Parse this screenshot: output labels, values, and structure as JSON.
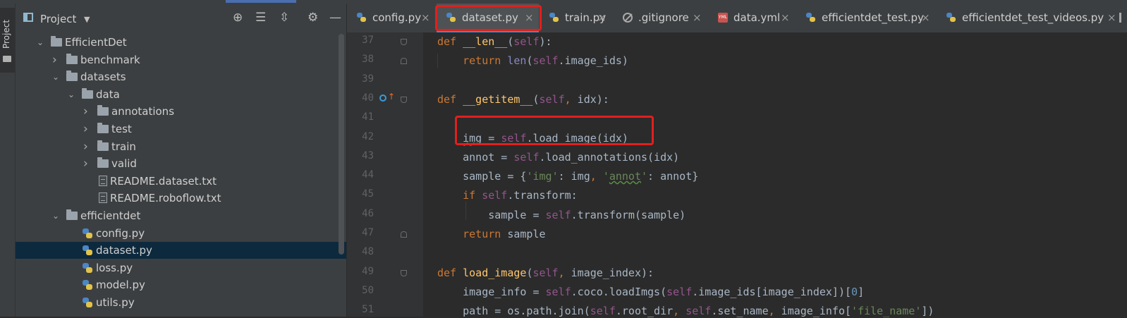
{
  "sidebar": {
    "stripe_label": "Project"
  },
  "project": {
    "title": "Project",
    "tree": [
      {
        "label": "EfficientDet",
        "kind": "folder",
        "depth": 0,
        "expanded": true
      },
      {
        "label": "benchmark",
        "kind": "folder",
        "depth": 1,
        "expanded": false
      },
      {
        "label": "datasets",
        "kind": "folder",
        "depth": 1,
        "expanded": true
      },
      {
        "label": "data",
        "kind": "folder",
        "depth": 2,
        "expanded": true
      },
      {
        "label": "annotations",
        "kind": "folder",
        "depth": 3,
        "expanded": false
      },
      {
        "label": "test",
        "kind": "folder",
        "depth": 3,
        "expanded": false
      },
      {
        "label": "train",
        "kind": "folder",
        "depth": 3,
        "expanded": false
      },
      {
        "label": "valid",
        "kind": "folder",
        "depth": 3,
        "expanded": false
      },
      {
        "label": "README.dataset.txt",
        "kind": "txt",
        "depth": 3
      },
      {
        "label": "README.roboflow.txt",
        "kind": "txt",
        "depth": 3
      },
      {
        "label": "efficientdet",
        "kind": "folder",
        "depth": 1,
        "expanded": true
      },
      {
        "label": "config.py",
        "kind": "py",
        "depth": 2
      },
      {
        "label": "dataset.py",
        "kind": "py",
        "depth": 2,
        "selected": true
      },
      {
        "label": "loss.py",
        "kind": "py",
        "depth": 2
      },
      {
        "label": "model.py",
        "kind": "py",
        "depth": 2
      },
      {
        "label": "utils.py",
        "kind": "py",
        "depth": 2
      }
    ]
  },
  "tabs": [
    {
      "label": "config.py",
      "icon": "python-icon"
    },
    {
      "label": "dataset.py",
      "icon": "python-icon",
      "active": true
    },
    {
      "label": "train.py",
      "icon": "python-icon"
    },
    {
      "label": ".gitignore",
      "icon": "gitignore-icon"
    },
    {
      "label": "data.yml",
      "icon": "yml-icon"
    },
    {
      "label": "efficientdet_test.py",
      "icon": "python-icon"
    },
    {
      "label": "efficientdet_test_videos.py",
      "icon": "python-icon"
    }
  ],
  "editor": {
    "line_numbers": [
      "37",
      "38",
      "39",
      "40",
      "41",
      "42",
      "43",
      "44",
      "45",
      "46",
      "47",
      "48",
      "49",
      "50",
      "51"
    ],
    "lines": [
      "def __len__(self):",
      "    return len(self.image_ids)",
      "",
      "def __getitem__(self, idx):",
      "",
      "    img = self.load_image(idx)",
      "    annot = self.load_annotations(idx)",
      "    sample = {'img': img, 'annot': annot}",
      "    if self.transform:",
      "        sample = self.transform(sample)",
      "    return sample",
      "",
      "def load_image(self, image_index):",
      "    image_info = self.coco.loadImgs(self.image_ids[image_index])[0]",
      "    path = os.path.join(self.root_dir, self.set_name, image_info['file_name'])"
    ]
  },
  "colors": {
    "highlight_box": "#e0201e",
    "selection": "#0d293e",
    "keyword": "#cc7832",
    "function": "#ffc66d",
    "self": "#94558d"
  }
}
